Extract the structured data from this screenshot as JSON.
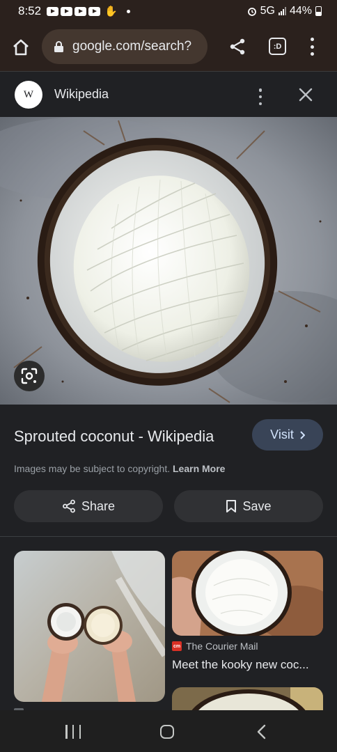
{
  "status_bar": {
    "time": "8:52",
    "network": "5G",
    "battery": "44%"
  },
  "browser": {
    "url": "google.com/search?",
    "tab_count": ":D"
  },
  "source": {
    "logo_letter": "W",
    "name": "Wikipedia"
  },
  "result": {
    "title": "Sprouted coconut - Wikipedia",
    "visit_label": "Visit",
    "copyright_text": "Images may be subject to copyright.",
    "learn_more": "Learn More",
    "share_label": "Share",
    "save_label": "Save"
  },
  "related": [
    {
      "source": "",
      "title": ""
    },
    {
      "source_icon_text": "cm",
      "source": "The Courier Mail",
      "title": "Meet the kooky new coc..."
    }
  ]
}
